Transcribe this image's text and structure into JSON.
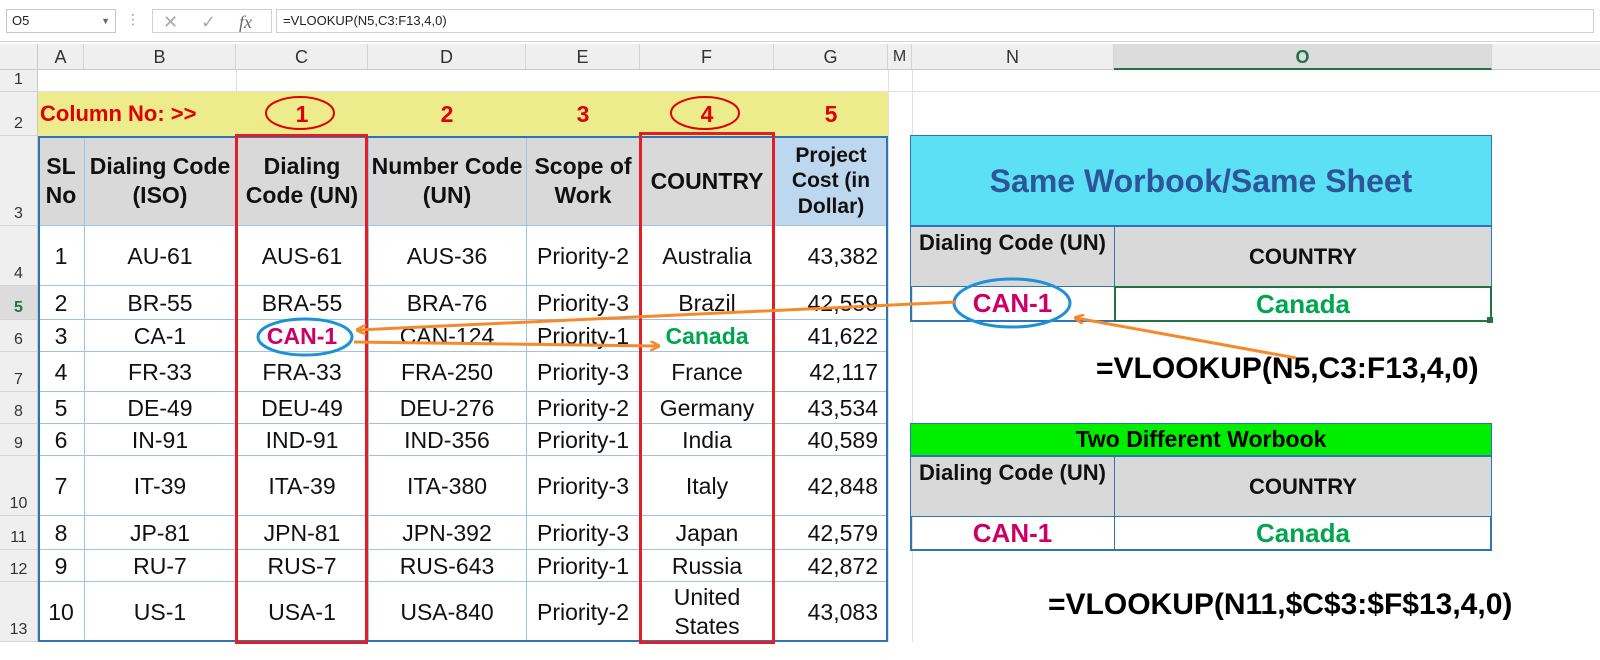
{
  "formula_bar": {
    "name_box": "O5",
    "formula": "=VLOOKUP(N5,C3:F13,4,0)",
    "fx": "fx",
    "cancel": "✕",
    "enter": "✓"
  },
  "columns": [
    "A",
    "B",
    "C",
    "D",
    "E",
    "F",
    "G",
    "M",
    "N",
    "O"
  ],
  "rows": [
    "1",
    "2",
    "3",
    "4",
    "5",
    "6",
    "7",
    "8",
    "9",
    "10",
    "11",
    "12",
    "13"
  ],
  "row2": {
    "label": "Column No: >>",
    "nums": [
      "1",
      "2",
      "3",
      "4",
      "5"
    ]
  },
  "headers": [
    "SL No",
    "Dialing Code (ISO)",
    "Dialing Code (UN)",
    "Number Code (UN)",
    "Scope of Work",
    "COUNTRY",
    "Project Cost (in Dollar)"
  ],
  "data": [
    [
      "1",
      "AU-61",
      "AUS-61",
      "AUS-36",
      "Priority-2",
      "Australia",
      "43,382"
    ],
    [
      "2",
      "BR-55",
      "BRA-55",
      "BRA-76",
      "Priority-3",
      "Brazil",
      "42,559"
    ],
    [
      "3",
      "CA-1",
      "CAN-1",
      "CAN-124",
      "Priority-1",
      "Canada",
      "41,622"
    ],
    [
      "4",
      "FR-33",
      "FRA-33",
      "FRA-250",
      "Priority-3",
      "France",
      "42,117"
    ],
    [
      "5",
      "DE-49",
      "DEU-49",
      "DEU-276",
      "Priority-2",
      "Germany",
      "43,534"
    ],
    [
      "6",
      "IN-91",
      "IND-91",
      "IND-356",
      "Priority-1",
      "India",
      "40,589"
    ],
    [
      "7",
      "IT-39",
      "ITA-39",
      "ITA-380",
      "Priority-3",
      "Italy",
      "42,848"
    ],
    [
      "8",
      "JP-81",
      "JPN-81",
      "JPN-392",
      "Priority-3",
      "Japan",
      "42,579"
    ],
    [
      "9",
      "RU-7",
      "RUS-7",
      "RUS-643",
      "Priority-1",
      "Russia",
      "42,872"
    ],
    [
      "10",
      "US-1",
      "USA-1",
      "USA-840",
      "Priority-2",
      "United States",
      "43,083"
    ]
  ],
  "box1": {
    "title": "Same Worbook/Same Sheet",
    "col1": "Dialing Code (UN)",
    "col2": "COUNTRY",
    "val1": "CAN-1",
    "val2": "Canada",
    "formula": "=VLOOKUP(N5,C3:F13,4,0)"
  },
  "box2": {
    "title": "Two Different Worbook",
    "col1": "Dialing Code (UN)",
    "col2": "COUNTRY",
    "val1": "CAN-1",
    "val2": "Canada",
    "formula": "=VLOOKUP(N11,$C$3:$F$13,4,0)"
  },
  "colors": {
    "pink": "#cc0066",
    "green": "#00a550",
    "red": "#e00000",
    "cyan": "#5be0f5",
    "lime": "#00ee00",
    "blue_header": "#2e75b6",
    "orange": "#f58a2c"
  }
}
